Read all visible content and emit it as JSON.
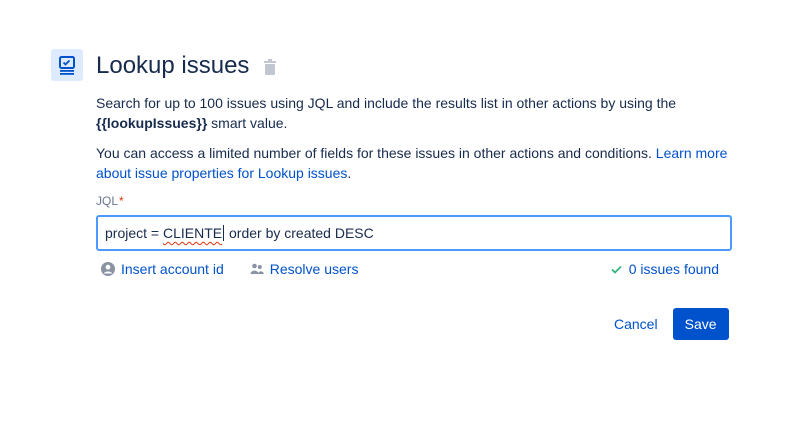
{
  "icons": {
    "action": "lookup-issues-icon",
    "delete": "trash-icon",
    "insert_account": "user-avatar-icon",
    "resolve_users": "people-icon",
    "status": "check-icon"
  },
  "colors": {
    "accent": "#0052cc",
    "icon_bg": "#deebff",
    "focus_border": "#4c9aff",
    "required": "#de350b"
  },
  "header": {
    "title": "Lookup issues"
  },
  "description": {
    "line1_prefix": "Search for up to 100 issues using JQL and include the results list in other actions by using the",
    "smart_value": "{{lookupIssues}}",
    "line1_suffix": " smart value.",
    "line2_text": "You can access a limited number of fields for these issues in other actions and conditions.",
    "line2_link": "Learn more about issue properties for Lookup issues",
    "line2_end": "."
  },
  "jql": {
    "label": "JQL",
    "required_mark": "*",
    "value_before": "project = ",
    "value_misspelled": "CLIENTE",
    "value_after": " order by created DESC"
  },
  "helpers": {
    "insert_account": "Insert account id",
    "resolve_users": "Resolve users",
    "status": "0 issues found"
  },
  "footer": {
    "cancel": "Cancel",
    "save": "Save"
  }
}
